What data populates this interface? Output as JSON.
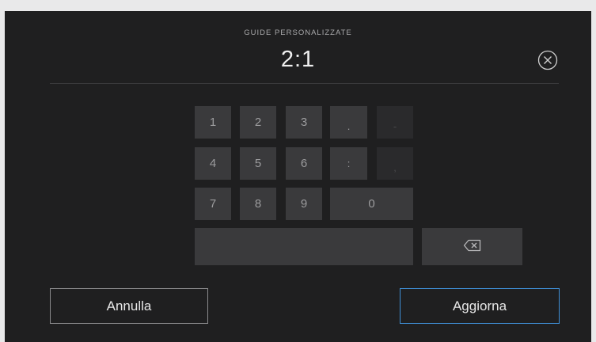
{
  "header": {
    "title": "GUIDE PERSONALIZZATE",
    "value": "2:1",
    "close_icon": "close-circle-icon"
  },
  "keypad": {
    "row1": [
      "1",
      "2",
      "3",
      ".",
      "-"
    ],
    "row2": [
      "4",
      "5",
      "6",
      ":",
      ","
    ],
    "row3": [
      "7",
      "8",
      "9",
      "0"
    ],
    "space_label": "",
    "backspace_icon": "backspace-icon",
    "disabled_keys": [
      "-",
      ","
    ]
  },
  "actions": {
    "cancel_label": "Annulla",
    "update_label": "Aggiorna"
  },
  "colors": {
    "background": "#1f1f20",
    "key": "#3a3a3c",
    "accent": "#3f8fd6"
  }
}
